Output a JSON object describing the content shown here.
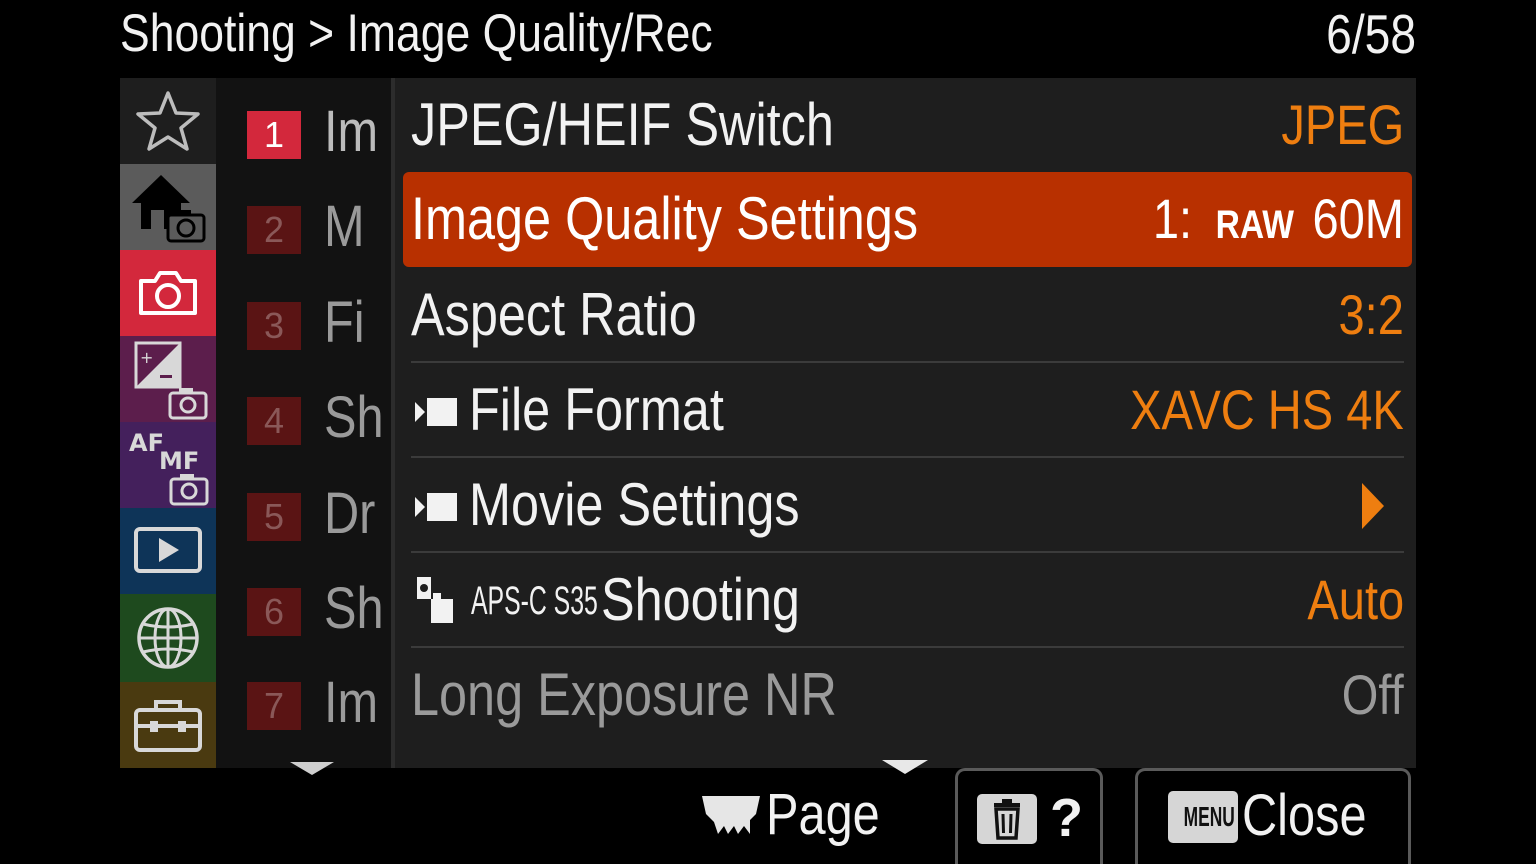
{
  "header": {
    "title": "Shooting > Image Quality/Rec",
    "page_counter": "6/58"
  },
  "tabs": [
    {
      "name": "My Menu",
      "icon": "star-icon",
      "color": "#1e1e1e",
      "active": false
    },
    {
      "name": "Main",
      "icon": "home-camera-icon",
      "color": "#5b5b5b",
      "active": false
    },
    {
      "name": "Shooting",
      "icon": "camera-icon",
      "color": "#d3283c",
      "active": true
    },
    {
      "name": "Exposure/Color",
      "icon": "exposure-camera-icon",
      "color": "#5c1e4c",
      "active": false
    },
    {
      "name": "Focus",
      "icon": "af-mf-camera-icon",
      "color": "#44205c",
      "active": false
    },
    {
      "name": "Playback",
      "icon": "playback-icon",
      "color": "#0e3458",
      "active": false
    },
    {
      "name": "Network",
      "icon": "globe-icon",
      "color": "#1e4a1e",
      "active": false
    },
    {
      "name": "Setup",
      "icon": "toolbox-icon",
      "color": "#4a3a10",
      "active": false
    }
  ],
  "subtabs": [
    {
      "number": "1",
      "label": "Im",
      "active": true
    },
    {
      "number": "2",
      "label": "M",
      "active": false
    },
    {
      "number": "3",
      "label": "Fi",
      "active": false
    },
    {
      "number": "4",
      "label": "Sh",
      "active": false
    },
    {
      "number": "5",
      "label": "Dr",
      "active": false
    },
    {
      "number": "6",
      "label": "Sh",
      "active": false
    },
    {
      "number": "7",
      "label": "Im",
      "active": false
    }
  ],
  "menu_items": {
    "jpeg_heif": {
      "label": "JPEG/HEIF Switch",
      "value": "JPEG"
    },
    "image_quality": {
      "label": "Image Quality Settings",
      "value_prefix": "1:",
      "value_badge": "RAW",
      "value": "60M"
    },
    "aspect_ratio": {
      "label": "Aspect Ratio",
      "value": "3:2"
    },
    "file_format": {
      "label": "File Format",
      "value": "XAVC HS 4K"
    },
    "movie_settings": {
      "label": "Movie Settings",
      "value": ""
    },
    "apsc_shooting": {
      "label_prefix": "APS-C S35",
      "label": "Shooting",
      "value": "Auto"
    },
    "long_exposure_nr": {
      "label": "Long Exposure NR",
      "value": "Off",
      "disabled": true
    }
  },
  "footer": {
    "page_label": "Page",
    "help_label": "?",
    "menu_key_label": "MENU",
    "close_label": "Close"
  },
  "colors": {
    "accent": "#b83000",
    "value": "#ee7e10",
    "active_tab": "#d3283c"
  }
}
